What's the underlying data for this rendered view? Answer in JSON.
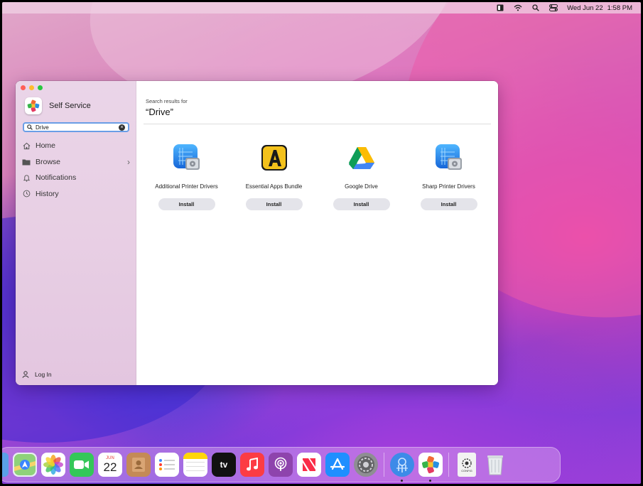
{
  "menubar": {
    "icons": [
      "finder-status-icon",
      "wifi-icon",
      "search-icon",
      "control-center-icon"
    ],
    "date": "Wed Jun 22",
    "time": "1:58 PM"
  },
  "window": {
    "app_title": "Self Service",
    "search": {
      "value": "Drive",
      "placeholder": "Search"
    },
    "nav": [
      {
        "label": "Home",
        "icon": "home-icon"
      },
      {
        "label": "Browse",
        "icon": "folder-icon"
      },
      {
        "label": "Notifications",
        "icon": "bell-icon"
      },
      {
        "label": "History",
        "icon": "clock-icon"
      }
    ],
    "login_label": "Log In",
    "results_label": "Search results for",
    "results_query": "“Drive”",
    "results": [
      {
        "name": "Additional Printer Drivers",
        "icon": "disk-utility-icon",
        "button": "Install"
      },
      {
        "name": "Essential Apps Bundle",
        "icon": "essential-apps-icon",
        "button": "Install"
      },
      {
        "name": "Google Drive",
        "icon": "google-drive-icon",
        "button": "Install"
      },
      {
        "name": "Sharp Printer Drivers",
        "icon": "disk-utility-icon",
        "button": "Install"
      }
    ]
  },
  "dock": {
    "calendar_month": "JUN",
    "calendar_day": "22",
    "tv_label": "tv",
    "config_label": "CONFIG"
  },
  "colors": {
    "search_border": "#6a9ee6",
    "install_button": "#e4e4ea",
    "sidebar": "#e8cfe4"
  }
}
